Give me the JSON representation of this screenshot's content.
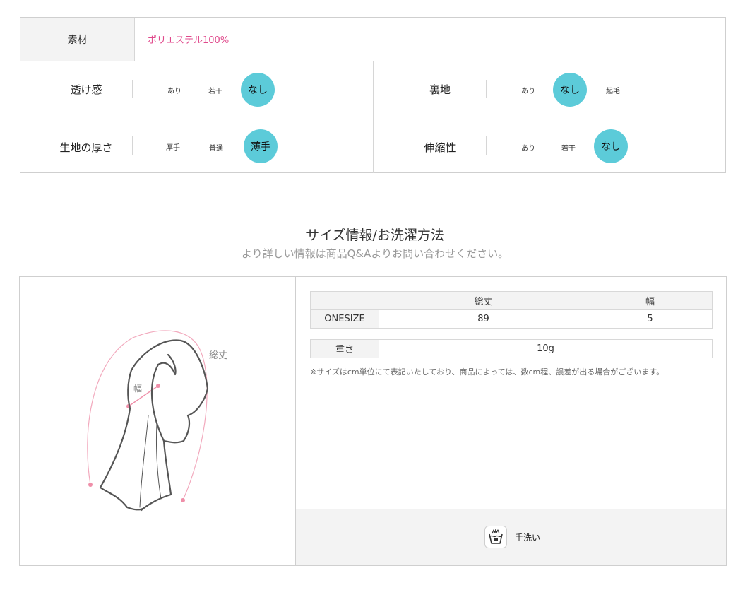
{
  "material": {
    "label": "素材",
    "value": "ポリエステル100%"
  },
  "attributes": {
    "transparency": {
      "label": "透け感",
      "options": [
        "あり",
        "若干"
      ],
      "selected": "なし"
    },
    "thickness": {
      "label": "生地の厚さ",
      "options": [
        "厚手",
        "普通"
      ],
      "selected": "薄手"
    },
    "lining": {
      "label": "裏地",
      "before": "あり",
      "selected": "なし",
      "after": "起毛"
    },
    "stretch": {
      "label": "伸縮性",
      "options": [
        "あり",
        "若干"
      ],
      "selected": "なし"
    }
  },
  "section": {
    "title": "サイズ情報/お洗濯方法",
    "subtitle": "より詳しい情報は商品Q&Aよりお問い合わせください。"
  },
  "diagram": {
    "length_label": "総丈",
    "width_label": "幅",
    "accent_color": "#f08aa8"
  },
  "size_table": {
    "headers": [
      "",
      "総丈",
      "幅"
    ],
    "rows": [
      {
        "size": "ONESIZE",
        "length": "89",
        "width": "5"
      }
    ]
  },
  "weight": {
    "label": "重さ",
    "value": "10g"
  },
  "note": "※サイズはcm単位にて表記いたしており、商品によっては、数cm程、誤差が出る場合がございます。",
  "care": {
    "icon": "hand-wash-icon",
    "label": "手洗い"
  },
  "colors": {
    "selected_circle": "#5ccbd9",
    "material_value": "#e04a8c"
  }
}
